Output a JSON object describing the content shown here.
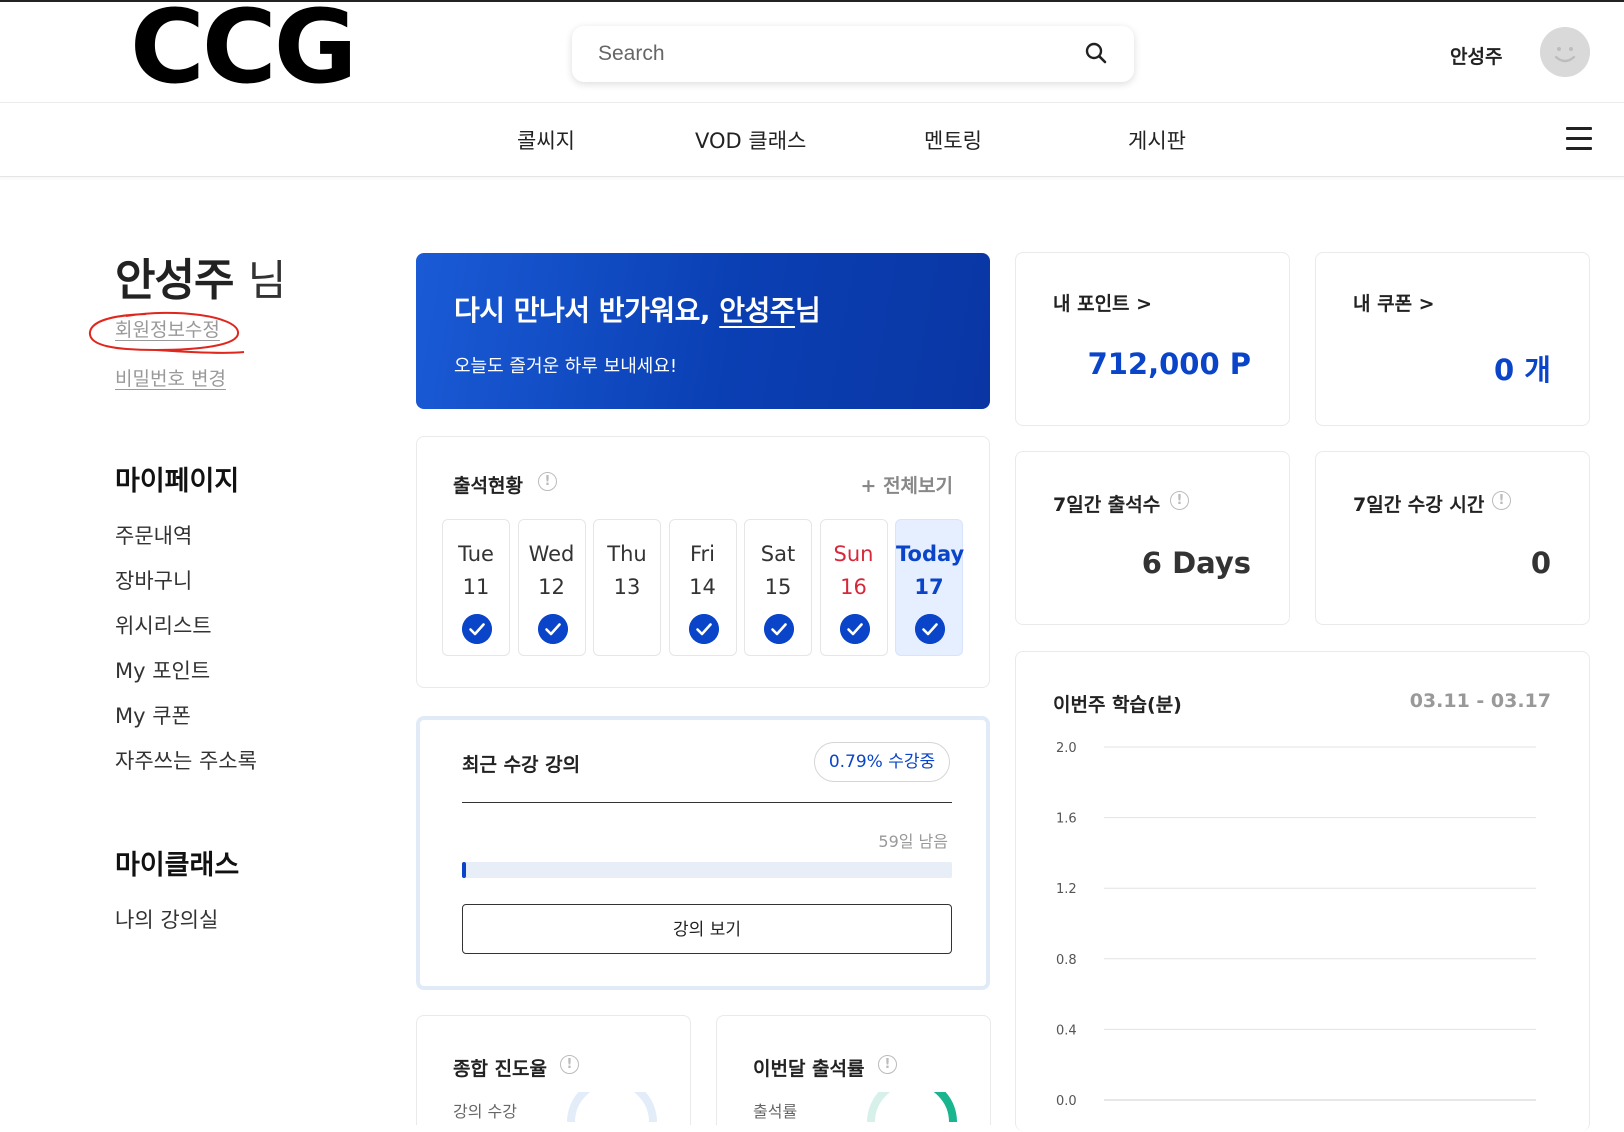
{
  "header": {
    "logo": "CCG",
    "search_placeholder": "Search",
    "user_name": "안성주"
  },
  "nav": {
    "items": [
      "콜씨지",
      "VOD 클래스",
      "멘토링",
      "게시판"
    ]
  },
  "sidebar": {
    "name": "안성주",
    "name_suffix": "님",
    "edit_profile": "회원정보수정",
    "change_password": "비밀번호 변경",
    "mypage_title": "마이페이지",
    "mypage_items": [
      "주문내역",
      "장바구니",
      "위시리스트",
      "My 포인트",
      "My 쿠폰",
      "자주쓰는 주소록"
    ],
    "myclass_title": "마이클래스",
    "myclass_items": [
      "나의 강의실"
    ]
  },
  "banner": {
    "greeting_prefix": "다시 만나서 반가워요, ",
    "greeting_name": "안성주",
    "greeting_suffix": "님",
    "subtext": "오늘도 즐거운 하루 보내세요!"
  },
  "points": {
    "title": "내 포인트 >",
    "value": "712,000 P"
  },
  "coupons": {
    "title": "내 쿠폰 >",
    "value": "0 개"
  },
  "attendance_7d": {
    "title": "7일간 출석수",
    "value": "6 Days"
  },
  "study_time_7d": {
    "title": "7일간 수강 시간",
    "value": "0"
  },
  "attendance": {
    "title": "출석현황",
    "view_all": "+ 전체보기",
    "days": [
      {
        "name": "Tue",
        "date": "11",
        "checked": true,
        "type": "normal"
      },
      {
        "name": "Wed",
        "date": "12",
        "checked": true,
        "type": "normal"
      },
      {
        "name": "Thu",
        "date": "13",
        "checked": false,
        "type": "normal"
      },
      {
        "name": "Fri",
        "date": "14",
        "checked": true,
        "type": "normal"
      },
      {
        "name": "Sat",
        "date": "15",
        "checked": true,
        "type": "normal"
      },
      {
        "name": "Sun",
        "date": "16",
        "checked": true,
        "type": "sunday"
      },
      {
        "name": "Today",
        "date": "17",
        "checked": true,
        "type": "today"
      }
    ]
  },
  "recent_course": {
    "title": "최근 수강 강의",
    "progress_label": "0.79% 수강중",
    "progress": 0.0079,
    "remaining": "59일 남음",
    "view_button": "강의 보기"
  },
  "overall_progress": {
    "title": "종합 진도율",
    "label": "강의 수강"
  },
  "monthly_attendance": {
    "title": "이번달 출석률",
    "label": "출석률"
  },
  "colors": {
    "accent": "#0a45c9",
    "sunday": "#d6283b"
  },
  "chart_data": {
    "type": "bar",
    "title": "이번주 학습(분)",
    "range": "03.11 - 03.17",
    "y_ticks": [
      "2.0",
      "1.6",
      "1.2",
      "0.8",
      "0.4",
      "0.0"
    ],
    "ylim": [
      0,
      2.0
    ],
    "grid": true
  }
}
